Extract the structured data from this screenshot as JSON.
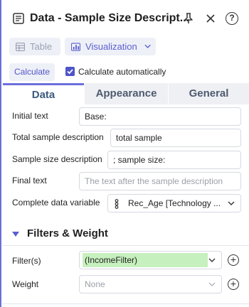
{
  "header": {
    "title": "Data - Sample Size Descript...",
    "help_label": "?"
  },
  "view_tabs": {
    "table_label": "Table",
    "visualization_label": "Visualization"
  },
  "calc": {
    "button_label": "Calculate",
    "auto_label": "Calculate automatically",
    "auto_checked": true
  },
  "section_tabs": {
    "data": "Data",
    "appearance": "Appearance",
    "general": "General"
  },
  "form": {
    "initial_text": {
      "label": "Initial text",
      "value": "Base:"
    },
    "total_sample": {
      "label": "Total sample description",
      "value": "total sample"
    },
    "sample_size": {
      "label": "Sample size description",
      "value": "; sample size:"
    },
    "final_text": {
      "label": "Final text",
      "placeholder": "The text after the sample description"
    },
    "complete_var": {
      "label": "Complete data variable",
      "value": "Rec_Age [Technology ..."
    }
  },
  "filters_weight": {
    "title": "Filters & Weight",
    "filter_label": "Filter(s)",
    "filter_value": "(IncomeFilter)",
    "weight_label": "Weight",
    "weight_value": "None",
    "plus_label": "+"
  },
  "colors": {
    "accent": "#6b6fdc",
    "filter_tag": "#c6f0bd"
  }
}
